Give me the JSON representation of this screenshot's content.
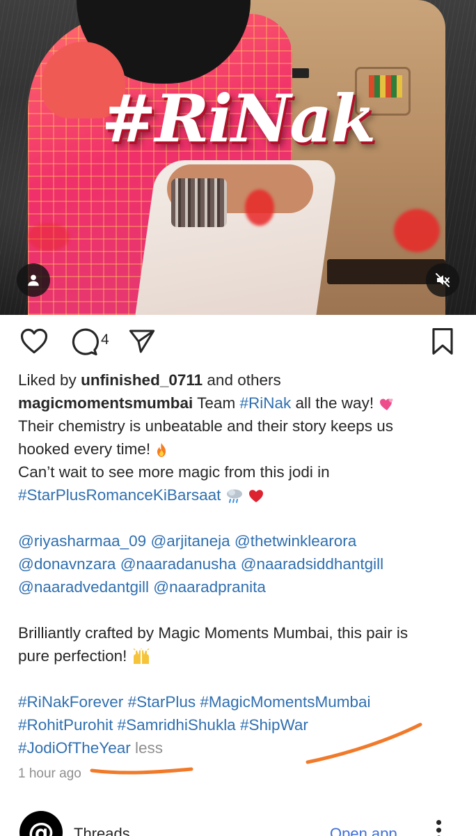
{
  "media": {
    "hashtag_overlay": "#RiNak",
    "user_button_icon": "person-icon",
    "mute_button_icon": "speaker-muted-icon"
  },
  "actions": {
    "like_icon": "heart-outline-icon",
    "comment_icon": "comment-bubble-icon",
    "comment_count": "4",
    "share_icon": "paper-plane-icon",
    "save_icon": "bookmark-outline-icon"
  },
  "likes": {
    "prefix": "Liked by",
    "user": "unfinished_0711",
    "suffix": "and others"
  },
  "caption": {
    "author": "magicmomentsmumbai",
    "line1_text": "Team",
    "line1_tag": "#RiNak",
    "line1_rest": "all the way!",
    "line2": "Their chemistry is unbeatable and their story keeps us",
    "line3": "hooked every time!",
    "line4": "Can’t wait to see more magic from this jodi in",
    "line5_tag": "#StarPlusRomanceKiBarsaat",
    "mentions_row1": [
      "@riyasharmaa_09",
      "@arjitaneja",
      "@thetwinklearora"
    ],
    "mentions_row2": [
      "@donavnzara",
      "@naaradanusha",
      "@naaradsiddhantgill"
    ],
    "mentions_row3": [
      "@naaradvedantgill",
      "@naaradpranita"
    ],
    "line_crafted1": "Brilliantly crafted by Magic Moments Mumbai, this pair is",
    "line_crafted2": "pure perfection!",
    "tags_row1": [
      "#RiNakForever",
      "#StarPlus",
      "#MagicMomentsMumbai"
    ],
    "tags_row2": [
      "#RohitPurohit",
      "#SamridhiShukla",
      "#ShipWar"
    ],
    "tags_row3": [
      "#JodiOfTheYear"
    ],
    "less_label": "less"
  },
  "timestamp": "1 hour ago",
  "banner": {
    "app_name": "Threads",
    "open_app_label": "Open app",
    "more_icon": "vertical-dots-icon"
  },
  "colors": {
    "link": "#2f6fb0",
    "annotation": "#f07a2a",
    "open_app": "#3f6fd8"
  }
}
